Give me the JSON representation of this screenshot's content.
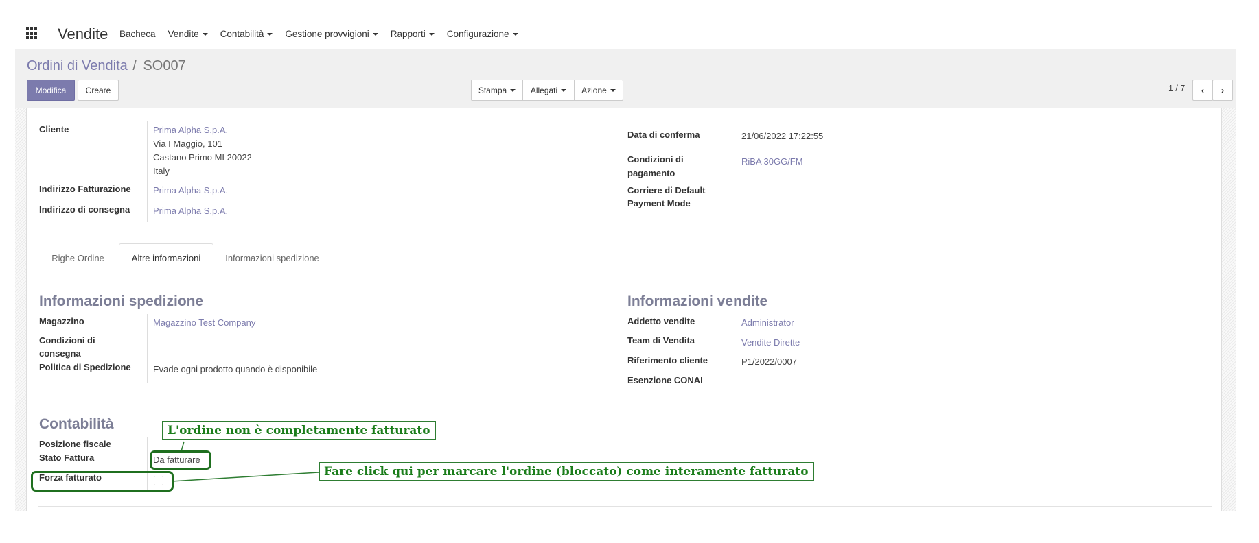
{
  "navbar": {
    "app_name": "Vendite",
    "menu": [
      "Bacheca",
      "Vendite",
      "Contabilità",
      "Gestione provvigioni",
      "Rapporti",
      "Configurazione"
    ]
  },
  "breadcrumb": {
    "parent": "Ordini di Vendita",
    "separator": "/",
    "current": "SO007"
  },
  "buttons": {
    "edit": "Modifica",
    "create": "Creare",
    "print": "Stampa",
    "attachments": "Allegati",
    "action": "Azione"
  },
  "pager": {
    "text": "1 / 7"
  },
  "left_fields": {
    "cliente_label": "Cliente",
    "cliente_name": "Prima Alpha S.p.A.",
    "cliente_street": "Via I Maggio, 101",
    "cliente_city": "Castano Primo MI 20022",
    "cliente_country": "Italy",
    "fatturazione_label": "Indirizzo Fatturazione",
    "fatturazione_value": "Prima Alpha S.p.A.",
    "consegna_label": "Indirizzo di consegna",
    "consegna_value": "Prima Alpha S.p.A."
  },
  "right_fields": {
    "conferma_label": "Data di conferma",
    "conferma_value": "21/06/2022 17:22:55",
    "pagamento_label_1": "Condizioni di",
    "pagamento_label_2": "pagamento",
    "pagamento_value": "RiBA 30GG/FM",
    "corriere_label": "Corriere di Default",
    "payment_mode_label": "Payment Mode"
  },
  "tabs": [
    "Righe Ordine",
    "Altre informazioni",
    "Informazioni spedizione"
  ],
  "spedizione": {
    "title": "Informazioni spedizione",
    "magazzino_label": "Magazzino",
    "magazzino_value": "Magazzino Test Company",
    "condizioni_label_1": "Condizioni di",
    "condizioni_label_2": "consegna",
    "politica_label": "Politica di Spedizione",
    "politica_value": "Evade ogni prodotto quando è disponibile"
  },
  "vendite": {
    "title": "Informazioni vendite",
    "addetto_label": "Addetto vendite",
    "addetto_value": "Administrator",
    "team_label": "Team di Vendita",
    "team_value": "Vendite Dirette",
    "riferimento_label": "Riferimento cliente",
    "riferimento_value": "P1/2022/0007",
    "esenzione_label": "Esenzione CONAI"
  },
  "contabilita": {
    "title": "Contabilità",
    "posizione_label": "Posizione fiscale",
    "stato_label": "Stato Fattura",
    "stato_value": "Da fatturare",
    "forza_label": "Forza fatturato",
    "forza_checked": false
  },
  "annotations": {
    "not_invoiced": "L'ordine non è completamente fatturato",
    "click_here": "Fare click qui per marcare l'ordine (bloccato) come interamente fatturato"
  },
  "colors": {
    "accent": "#7c7bad",
    "annotation": "#2e7d32"
  }
}
